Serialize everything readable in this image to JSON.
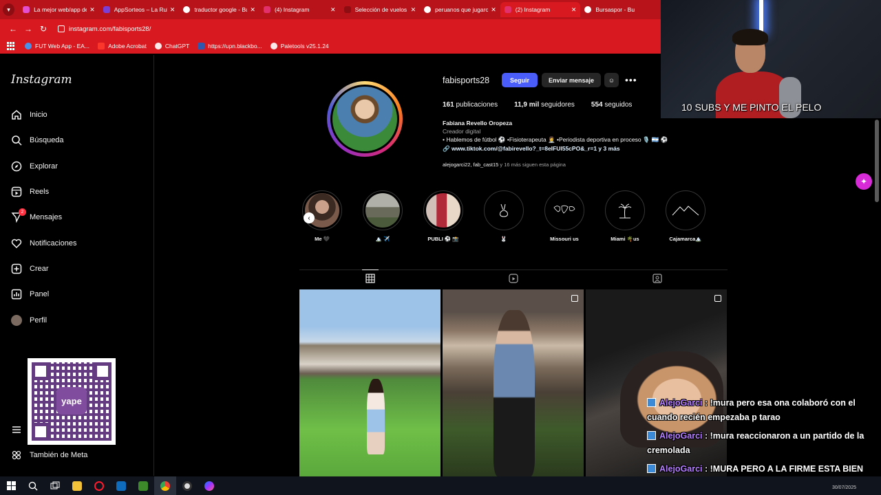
{
  "browser": {
    "tabs": [
      {
        "title": "La mejor web/app de",
        "color": "#e34fd0"
      },
      {
        "title": "AppSorteos – La Rule",
        "color": "#7c3fd6"
      },
      {
        "title": "traductor google - Bu",
        "color": "#ffffff"
      },
      {
        "title": "(4) Instagram",
        "color": "#e1306c"
      },
      {
        "title": "Selección de vuelos |",
        "color": "#d8191f"
      },
      {
        "title": "peruanos que jugaro",
        "color": "#ffffff"
      },
      {
        "title": "(2) Instagram",
        "color": "#e1306c"
      },
      {
        "title": "Bursaspor - Bu",
        "color": "#ffffff"
      }
    ],
    "active_tab": 6,
    "url": "instagram.com/fabisports28/",
    "bookmarks": [
      "FUT Web App - EA...",
      "Adobe Acrobat",
      "ChatGPT",
      "https://upn.blackbo...",
      "Paletools v25.1.24"
    ]
  },
  "sidebar": {
    "logo": "Instagram",
    "items": [
      {
        "label": "Inicio",
        "icon": "home-icon"
      },
      {
        "label": "Búsqueda",
        "icon": "search-icon"
      },
      {
        "label": "Explorar",
        "icon": "compass-icon"
      },
      {
        "label": "Reels",
        "icon": "reels-icon"
      },
      {
        "label": "Mensajes",
        "icon": "messenger-icon",
        "badge": "2"
      },
      {
        "label": "Notificaciones",
        "icon": "heart-icon"
      },
      {
        "label": "Crear",
        "icon": "plus-square-icon"
      },
      {
        "label": "Panel",
        "icon": "chart-icon"
      },
      {
        "label": "Perfil",
        "icon": "avatar-icon"
      }
    ],
    "more_label": "También de Meta",
    "qr_text": "yape"
  },
  "profile": {
    "username": "fabisports28",
    "follow_label": "Seguir",
    "message_label": "Enviar mensaje",
    "stats": {
      "posts": "161",
      "posts_label": "publicaciones",
      "followers": "11,9 mil",
      "followers_label": "seguidores",
      "following": "554",
      "following_label": "seguidos"
    },
    "name": "Fabiana Revello Oropeza",
    "category": "Creador digital",
    "bio": "• Hablemos de fútbol ⚽ •Fisioterapeuta 👩‍⚕️ •Periodista deportiva en proceso 🎙️ 🇦🇷 ⚽",
    "link": "www.tiktok.com/@fabirevello?_t=8eIFUI55cPO&_r=1 y 3 más",
    "followed_by_users": "alejogarci22, fab_cast15",
    "followed_by_rest": " y 16 más siguen esta página"
  },
  "highlights": [
    {
      "label": "Me 🖤"
    },
    {
      "label": "🏔️ ✈️"
    },
    {
      "label": "PUBLI ⚽ 📸"
    },
    {
      "label": "🐰"
    },
    {
      "label": "Missouri us"
    },
    {
      "label": "Miami 🌴us"
    },
    {
      "label": "Cajamarca🏔️"
    }
  ],
  "stream": {
    "overlay_text": "10 SUBS Y ME PINTO EL PELO",
    "chat": [
      {
        "user": "AlejoGarci",
        "text": "!mura pero esa ona colaboró con el cuando recién empezaba p tarao"
      },
      {
        "user": "AlejoGarci",
        "text": "!mura reaccionaron a un partido de la cremolada"
      },
      {
        "user": "AlejoGarci",
        "text": "!MURA PERO A LA FIRME ESTA BIEN RICA BUENAS BALAS TIENE CONCHADESUMARES"
      }
    ]
  },
  "messages_pill": {
    "label": "Mensajes",
    "badge": "2"
  },
  "taskbar": {
    "clock": "30/07/2025"
  }
}
